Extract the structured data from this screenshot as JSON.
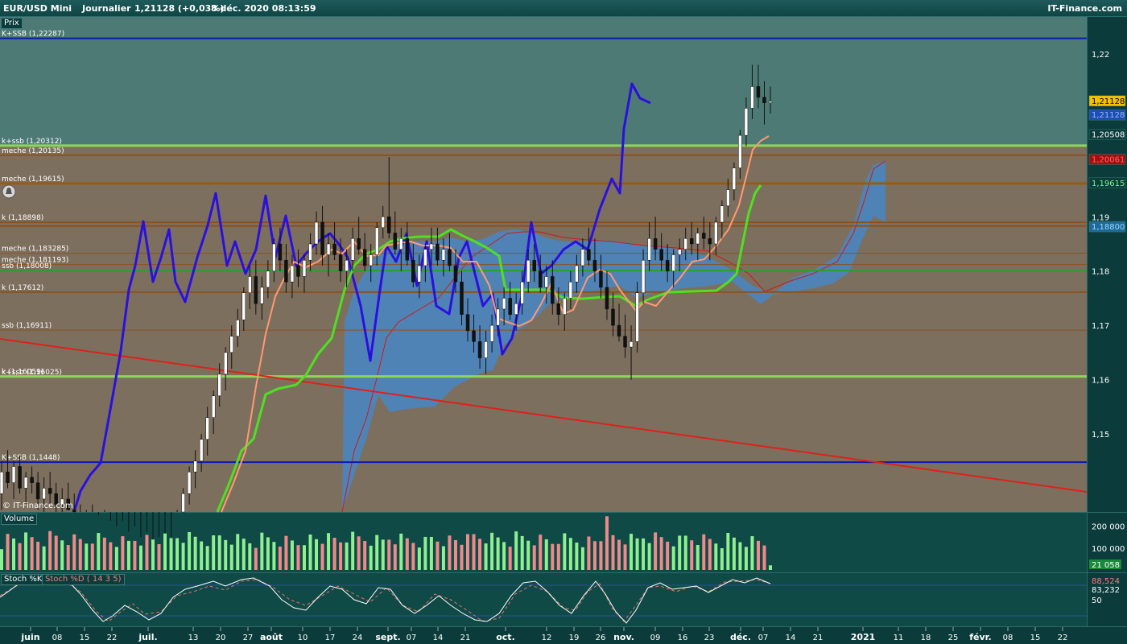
{
  "header": {
    "symbol": "EUR/USD Mini",
    "period": "Journalier",
    "quote": "1,21128 (+0,03%)",
    "datetime": "8 déc. 2020 08:13:59",
    "brand": "IT-Finance.com"
  },
  "price_panel": {
    "label": "Prix",
    "watermark": "© IT-Finance.com",
    "axis_ticks": [
      {
        "v": 1.22,
        "t": "1,22"
      },
      {
        "v": 1.19,
        "t": "1,19"
      },
      {
        "v": 1.18,
        "t": "1,18"
      },
      {
        "v": 1.17,
        "t": "1,17"
      },
      {
        "v": 1.16,
        "t": "1,16"
      },
      {
        "v": 1.15,
        "t": "1,15"
      }
    ],
    "price_tags": [
      {
        "v": 1.21128,
        "t": "1,21128",
        "bg": "#f2c200",
        "fg": "#000000"
      },
      {
        "v": 1.2087,
        "t": "1,21128",
        "bg": "#1b4fb8",
        "fg": "#9fb4e8"
      },
      {
        "v": 1.20508,
        "t": "1,20508",
        "bg": "#0b3b3b",
        "fg": "#ffffff"
      },
      {
        "v": 1.2005,
        "t": "1,20061",
        "bg": "#a01010",
        "fg": "#ff6666"
      },
      {
        "v": 1.19615,
        "t": "1,19615",
        "bg": "#0b3b3b",
        "fg": "#7cff7c"
      },
      {
        "v": 1.1881,
        "t": "1,18800",
        "bg": "#1b6a9a",
        "fg": "#9fd4ff"
      }
    ],
    "levels": [
      {
        "v": 1.22287,
        "label": "K+SSB (1,22287)",
        "color": "#0a1aa8",
        "w": 2
      },
      {
        "v": 1.20312,
        "label": "k+ssb (1,20312)",
        "color": "#8cd65a",
        "w": 3
      },
      {
        "v": 1.20135,
        "label": "meche (1,20135)",
        "color": "#8a5220",
        "w": 2
      },
      {
        "v": 1.19615,
        "label": "meche (1,19615)",
        "color": "#9a5a10",
        "w": 3
      },
      {
        "v": 1.18898,
        "label": "k (1,18898)",
        "color": "#8a5220",
        "w": 2
      },
      {
        "v": 1.1883,
        "label": "",
        "color": "#8a5220",
        "w": 2
      },
      {
        "v": 1.183285,
        "label": "meche (1,183285)",
        "color": "#8a5220",
        "w": 1
      },
      {
        "v": 1.181193,
        "label": "meche (1,181193)",
        "color": "#8a5220",
        "w": 1
      },
      {
        "v": 1.18008,
        "label": "ssb (1,18008)",
        "color": "#2aa02a",
        "w": 2
      },
      {
        "v": 1.17612,
        "label": "k (1,17612)",
        "color": "#8a5220",
        "w": 2
      },
      {
        "v": 1.16911,
        "label": "ssb (1,16911)",
        "color": "#8a5220",
        "w": 1
      },
      {
        "v": 1.16059,
        "label": "k (1,16059)",
        "color": "#8cd65a",
        "w": 3
      },
      {
        "v": 1.1448,
        "label": "K+SSB (1,1448)",
        "color": "#0a1aa8",
        "w": 2
      }
    ],
    "level_overlap_label": "k+ssb (1,16025)"
  },
  "volume_panel": {
    "label": "Volume",
    "axis_ticks": [
      {
        "v": 200000,
        "t": "200 000"
      },
      {
        "v": 100000,
        "t": "100 000"
      }
    ],
    "last_tag": "21 058"
  },
  "stoch_panel": {
    "label_k": "Stoch %K",
    "label_d": "Stoch %D ( 14 3 5)",
    "tag_d": "88,524",
    "tag_k": "83,232",
    "tick_50": "50"
  },
  "x_axis": {
    "ticks": [
      {
        "x": 38,
        "t": "juin",
        "b": true
      },
      {
        "x": 71,
        "t": "08"
      },
      {
        "x": 105,
        "t": "15"
      },
      {
        "x": 139,
        "t": "22"
      },
      {
        "x": 184,
        "t": "juil.",
        "b": true
      },
      {
        "x": 240,
        "t": "13"
      },
      {
        "x": 274,
        "t": "20"
      },
      {
        "x": 308,
        "t": "27"
      },
      {
        "x": 337,
        "t": "août",
        "b": true
      },
      {
        "x": 376,
        "t": "10"
      },
      {
        "x": 410,
        "t": "17"
      },
      {
        "x": 444,
        "t": "24"
      },
      {
        "x": 482,
        "t": "sept.",
        "b": true
      },
      {
        "x": 511,
        "t": "07"
      },
      {
        "x": 544,
        "t": "14"
      },
      {
        "x": 578,
        "t": "21"
      },
      {
        "x": 628,
        "t": "oct.",
        "b": true
      },
      {
        "x": 679,
        "t": "12"
      },
      {
        "x": 713,
        "t": "19"
      },
      {
        "x": 746,
        "t": "26"
      },
      {
        "x": 775,
        "t": "nov.",
        "b": true
      },
      {
        "x": 814,
        "t": "09"
      },
      {
        "x": 848,
        "t": "16"
      },
      {
        "x": 881,
        "t": "23"
      },
      {
        "x": 920,
        "t": "déc.",
        "b": true
      },
      {
        "x": 948,
        "t": "07"
      },
      {
        "x": 982,
        "t": "14"
      },
      {
        "x": 1016,
        "t": "21"
      },
      {
        "x": 1072,
        "t": "2021",
        "b": true
      },
      {
        "x": 1116,
        "t": "11"
      },
      {
        "x": 1150,
        "t": "18"
      },
      {
        "x": 1184,
        "t": "25"
      },
      {
        "x": 1218,
        "t": "févr.",
        "b": true
      },
      {
        "x": 1252,
        "t": "08"
      },
      {
        "x": 1286,
        "t": "15"
      },
      {
        "x": 1320,
        "t": "22"
      }
    ]
  },
  "chart_data": {
    "type": "candlestick",
    "instrument": "EUR/USD Mini",
    "period": "Journalier",
    "y_range": [
      1.1355,
      1.2283
    ],
    "note_values": "approximate daily OHLC readings",
    "candles": [
      [
        1.139,
        1.145,
        1.136,
        1.143
      ],
      [
        1.143,
        1.147,
        1.14,
        1.141
      ],
      [
        1.141,
        1.145,
        1.138,
        1.144
      ],
      [
        1.144,
        1.146,
        1.139,
        1.14
      ],
      [
        1.14,
        1.143,
        1.137,
        1.142
      ],
      [
        1.142,
        1.144,
        1.139,
        1.141
      ],
      [
        1.141,
        1.143,
        1.136,
        1.138
      ],
      [
        1.138,
        1.142,
        1.135,
        1.14
      ],
      [
        1.14,
        1.143,
        1.137,
        1.139
      ],
      [
        1.139,
        1.141,
        1.135,
        1.137
      ],
      [
        1.137,
        1.14,
        1.134,
        1.138
      ],
      [
        1.138,
        1.141,
        1.136,
        1.136
      ],
      [
        1.136,
        1.139,
        1.133,
        1.135
      ],
      [
        1.135,
        1.137,
        1.131,
        1.133
      ],
      [
        1.133,
        1.136,
        1.13,
        1.134
      ],
      [
        1.134,
        1.137,
        1.131,
        1.132
      ],
      [
        1.132,
        1.135,
        1.129,
        1.133
      ],
      [
        1.133,
        1.136,
        1.13,
        1.131
      ],
      [
        1.131,
        1.134,
        1.128,
        1.13
      ],
      [
        1.13,
        1.133,
        1.127,
        1.131
      ],
      [
        1.131,
        1.134,
        1.128,
        1.129
      ],
      [
        1.129,
        1.132,
        1.126,
        1.13
      ],
      [
        1.13,
        1.133,
        1.127,
        1.128
      ],
      [
        1.128,
        1.131,
        1.125,
        1.129
      ],
      [
        1.129,
        1.132,
        1.126,
        1.127
      ],
      [
        1.127,
        1.13,
        1.124,
        1.128
      ],
      [
        1.128,
        1.131,
        1.125,
        1.126
      ],
      [
        1.126,
        1.129,
        1.123,
        1.127
      ],
      [
        1.127,
        1.131,
        1.125,
        1.13
      ],
      [
        1.13,
        1.136,
        1.128,
        1.135
      ],
      [
        1.135,
        1.14,
        1.133,
        1.139
      ],
      [
        1.139,
        1.144,
        1.137,
        1.143
      ],
      [
        1.143,
        1.147,
        1.14,
        1.145
      ],
      [
        1.145,
        1.15,
        1.143,
        1.149
      ],
      [
        1.149,
        1.155,
        1.146,
        1.153
      ],
      [
        1.153,
        1.158,
        1.15,
        1.157
      ],
      [
        1.157,
        1.163,
        1.155,
        1.161
      ],
      [
        1.161,
        1.166,
        1.158,
        1.165
      ],
      [
        1.165,
        1.17,
        1.162,
        1.168
      ],
      [
        1.168,
        1.173,
        1.166,
        1.171
      ],
      [
        1.171,
        1.177,
        1.169,
        1.176
      ],
      [
        1.176,
        1.181,
        1.173,
        1.179
      ],
      [
        1.179,
        1.182,
        1.172,
        1.174
      ],
      [
        1.174,
        1.179,
        1.171,
        1.177
      ],
      [
        1.177,
        1.182,
        1.175,
        1.18
      ],
      [
        1.18,
        1.186,
        1.178,
        1.185
      ],
      [
        1.185,
        1.188,
        1.18,
        1.182
      ],
      [
        1.182,
        1.185,
        1.176,
        1.178
      ],
      [
        1.178,
        1.183,
        1.175,
        1.181
      ],
      [
        1.181,
        1.184,
        1.177,
        1.179
      ],
      [
        1.179,
        1.183,
        1.176,
        1.182
      ],
      [
        1.182,
        1.187,
        1.18,
        1.185
      ],
      [
        1.185,
        1.191,
        1.183,
        1.189
      ],
      [
        1.189,
        1.192,
        1.181,
        1.183
      ],
      [
        1.183,
        1.187,
        1.179,
        1.185
      ],
      [
        1.185,
        1.189,
        1.182,
        1.183
      ],
      [
        1.183,
        1.186,
        1.178,
        1.18
      ],
      [
        1.18,
        1.184,
        1.177,
        1.182
      ],
      [
        1.182,
        1.188,
        1.18,
        1.186
      ],
      [
        1.186,
        1.19,
        1.183,
        1.184
      ],
      [
        1.184,
        1.187,
        1.18,
        1.181
      ],
      [
        1.181,
        1.185,
        1.178,
        1.183
      ],
      [
        1.183,
        1.189,
        1.181,
        1.188
      ],
      [
        1.188,
        1.192,
        1.186,
        1.19
      ],
      [
        1.19,
        1.201,
        1.186,
        1.187
      ],
      [
        1.187,
        1.191,
        1.183,
        1.184
      ],
      [
        1.184,
        1.188,
        1.18,
        1.186
      ],
      [
        1.186,
        1.189,
        1.181,
        1.182
      ],
      [
        1.182,
        1.185,
        1.177,
        1.178
      ],
      [
        1.178,
        1.183,
        1.175,
        1.181
      ],
      [
        1.181,
        1.185,
        1.178,
        1.184
      ],
      [
        1.184,
        1.188,
        1.181,
        1.185
      ],
      [
        1.185,
        1.188,
        1.181,
        1.182
      ],
      [
        1.182,
        1.186,
        1.179,
        1.184
      ],
      [
        1.184,
        1.187,
        1.18,
        1.181
      ],
      [
        1.181,
        1.184,
        1.176,
        1.178
      ],
      [
        1.178,
        1.18,
        1.17,
        1.172
      ],
      [
        1.172,
        1.175,
        1.167,
        1.169
      ],
      [
        1.169,
        1.172,
        1.165,
        1.167
      ],
      [
        1.167,
        1.17,
        1.162,
        1.164
      ],
      [
        1.164,
        1.169,
        1.161,
        1.167
      ],
      [
        1.167,
        1.172,
        1.165,
        1.17
      ],
      [
        1.17,
        1.175,
        1.168,
        1.173
      ],
      [
        1.173,
        1.177,
        1.17,
        1.175
      ],
      [
        1.175,
        1.178,
        1.171,
        1.172
      ],
      [
        1.172,
        1.176,
        1.169,
        1.174
      ],
      [
        1.174,
        1.18,
        1.172,
        1.178
      ],
      [
        1.178,
        1.184,
        1.176,
        1.182
      ],
      [
        1.182,
        1.185,
        1.178,
        1.18
      ],
      [
        1.18,
        1.183,
        1.176,
        1.177
      ],
      [
        1.177,
        1.181,
        1.174,
        1.179
      ],
      [
        1.179,
        1.182,
        1.172,
        1.174
      ],
      [
        1.174,
        1.177,
        1.17,
        1.172
      ],
      [
        1.172,
        1.176,
        1.169,
        1.175
      ],
      [
        1.175,
        1.18,
        1.173,
        1.178
      ],
      [
        1.178,
        1.183,
        1.176,
        1.181
      ],
      [
        1.181,
        1.186,
        1.179,
        1.184
      ],
      [
        1.184,
        1.188,
        1.181,
        1.182
      ],
      [
        1.182,
        1.186,
        1.178,
        1.18
      ],
      [
        1.18,
        1.183,
        1.175,
        1.177
      ],
      [
        1.177,
        1.18,
        1.171,
        1.173
      ],
      [
        1.173,
        1.176,
        1.168,
        1.17
      ],
      [
        1.17,
        1.174,
        1.167,
        1.168
      ],
      [
        1.168,
        1.172,
        1.164,
        1.166
      ],
      [
        1.166,
        1.17,
        1.16,
        1.167
      ],
      [
        1.167,
        1.178,
        1.165,
        1.176
      ],
      [
        1.176,
        1.184,
        1.174,
        1.182
      ],
      [
        1.182,
        1.189,
        1.18,
        1.186
      ],
      [
        1.186,
        1.19,
        1.182,
        1.184
      ],
      [
        1.184,
        1.187,
        1.18,
        1.182
      ],
      [
        1.182,
        1.185,
        1.178,
        1.18
      ],
      [
        1.18,
        1.184,
        1.177,
        1.183
      ],
      [
        1.183,
        1.186,
        1.18,
        1.184
      ],
      [
        1.184,
        1.188,
        1.182,
        1.186
      ],
      [
        1.186,
        1.189,
        1.183,
        1.185
      ],
      [
        1.185,
        1.188,
        1.182,
        1.187
      ],
      [
        1.187,
        1.19,
        1.184,
        1.186
      ],
      [
        1.186,
        1.189,
        1.182,
        1.185
      ],
      [
        1.185,
        1.19,
        1.183,
        1.189
      ],
      [
        1.189,
        1.193,
        1.186,
        1.192
      ],
      [
        1.192,
        1.197,
        1.19,
        1.195
      ],
      [
        1.195,
        1.2,
        1.193,
        1.199
      ],
      [
        1.199,
        1.206,
        1.197,
        1.205
      ],
      [
        1.205,
        1.212,
        1.203,
        1.21
      ],
      [
        1.21,
        1.218,
        1.208,
        1.214
      ],
      [
        1.214,
        1.218,
        1.21,
        1.212
      ],
      [
        1.212,
        1.215,
        1.207,
        1.211
      ],
      [
        1.211,
        1.214,
        1.209,
        1.21128
      ]
    ],
    "indicators": [
      "Kijun",
      "Tenkan",
      "Chikou",
      "Senkou Span B",
      "Kumo"
    ]
  }
}
